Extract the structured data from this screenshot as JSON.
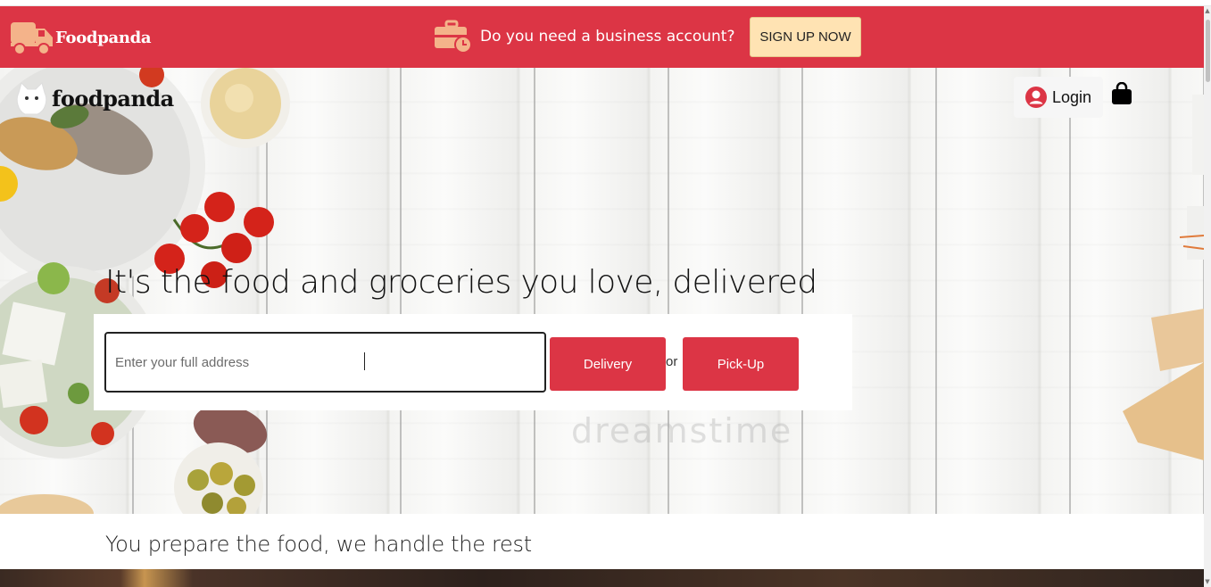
{
  "promo_bar": {
    "brand": "Foodpanda",
    "question": "Do you need a business account?",
    "signup_label": "SIGN UP NOW"
  },
  "header": {
    "logo_text": "foodpanda",
    "login_label": "Login"
  },
  "hero": {
    "headline": "It's the food and groceries you love, delivered",
    "address_placeholder": "Enter your full address",
    "delivery_label": "Delivery",
    "or_text": "or",
    "pickup_label": "Pick-Up",
    "watermark": "dreamstime"
  },
  "section": {
    "subheading": "You prepare the food, we handle the rest"
  },
  "colors": {
    "brand_red": "#dc3545",
    "signup_bg": "#ffe3b3",
    "text_dark": "#111111"
  },
  "icons": [
    "truck-icon",
    "briefcase-clock-icon",
    "panda-cat-icon",
    "user-circle-icon",
    "shopping-bag-icon"
  ]
}
